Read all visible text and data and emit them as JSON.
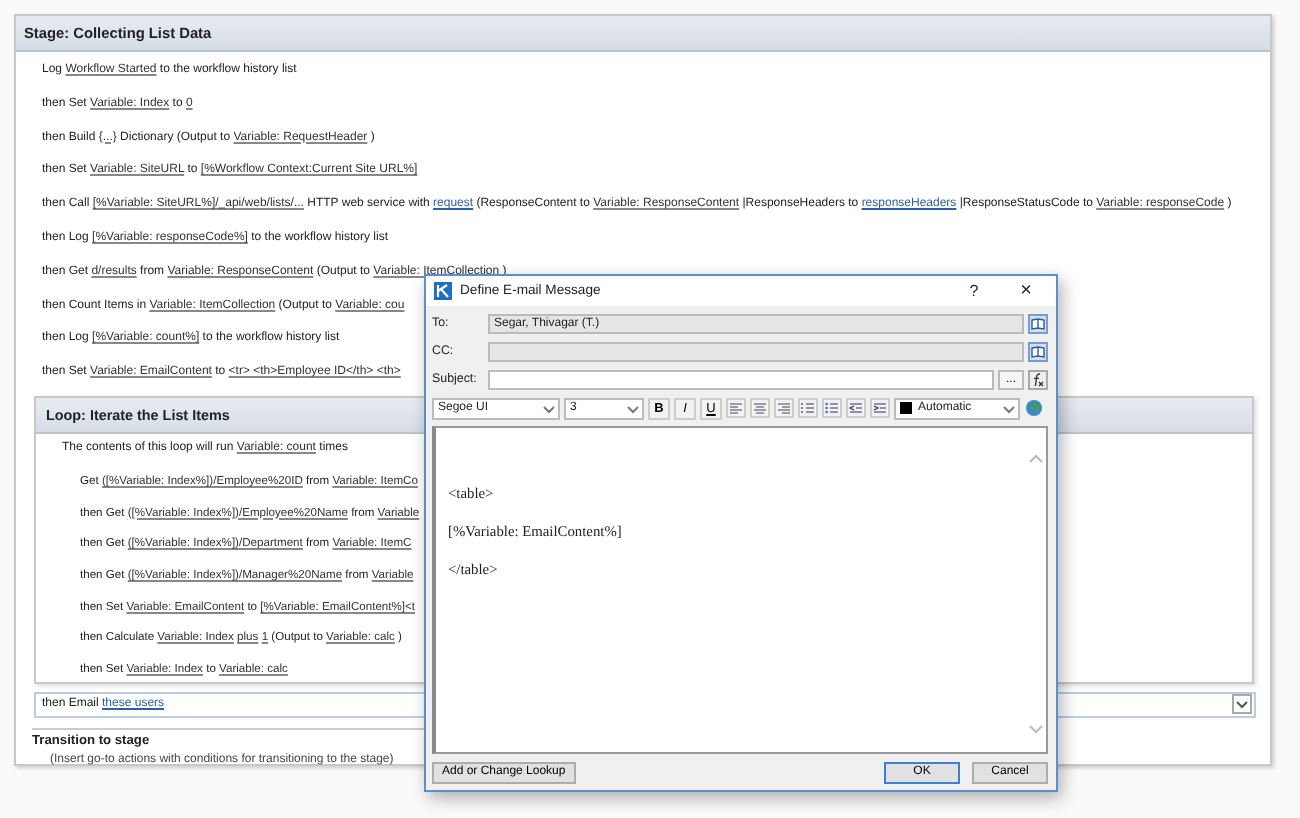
{
  "stage": {
    "title": "Stage: Collecting List Data",
    "actions": [
      {
        "segments": [
          {
            "kind": "text",
            "text": "Log "
          },
          {
            "kind": "var",
            "text": "Workflow Started"
          },
          {
            "kind": "text",
            "text": " to the workflow history list"
          }
        ]
      },
      {
        "segments": [
          {
            "kind": "text",
            "text": "then Set "
          },
          {
            "kind": "var",
            "text": "Variable: Index"
          },
          {
            "kind": "text",
            "text": " to "
          },
          {
            "kind": "var",
            "text": "0"
          }
        ]
      },
      {
        "segments": [
          {
            "kind": "text",
            "text": "then Build "
          },
          {
            "kind": "var",
            "text": "{...}"
          },
          {
            "kind": "text",
            "text": " Dictionary (Output to "
          },
          {
            "kind": "var",
            "text": "Variable: RequestHeader"
          },
          {
            "kind": "text",
            "text": " )"
          }
        ]
      },
      {
        "segments": [
          {
            "kind": "text",
            "text": "then Set "
          },
          {
            "kind": "var",
            "text": "Variable: SiteURL"
          },
          {
            "kind": "text",
            "text": " to "
          },
          {
            "kind": "var",
            "text": "[%Workflow Context:Current Site URL%]"
          }
        ]
      },
      {
        "segments": [
          {
            "kind": "text",
            "text": "then Call "
          },
          {
            "kind": "var",
            "text": "[%Variable: SiteURL%]/_api/web/lists/..."
          },
          {
            "kind": "text",
            "text": " HTTP web service with "
          },
          {
            "kind": "param",
            "text": "request"
          },
          {
            "kind": "text",
            "text": " (ResponseContent to "
          },
          {
            "kind": "var",
            "text": "Variable: ResponseContent"
          },
          {
            "kind": "text",
            "text": " |ResponseHeaders to "
          },
          {
            "kind": "param",
            "text": "responseHeaders"
          },
          {
            "kind": "text",
            "text": " |ResponseStatusCode to "
          },
          {
            "kind": "var",
            "text": "Variable: responseCode"
          },
          {
            "kind": "text",
            "text": " )"
          }
        ]
      },
      {
        "segments": [
          {
            "kind": "text",
            "text": "then Log "
          },
          {
            "kind": "var",
            "text": "[%Variable: responseCode%]"
          },
          {
            "kind": "text",
            "text": " to the workflow history list"
          }
        ]
      },
      {
        "segments": [
          {
            "kind": "text",
            "text": "then Get "
          },
          {
            "kind": "var",
            "text": "d/results"
          },
          {
            "kind": "text",
            "text": " from "
          },
          {
            "kind": "var",
            "text": "Variable: ResponseContent"
          },
          {
            "kind": "text",
            "text": " (Output to "
          },
          {
            "kind": "var",
            "text": "Variable: ItemCollection"
          },
          {
            "kind": "text",
            "text": " )"
          }
        ]
      },
      {
        "segments": [
          {
            "kind": "text",
            "text": "then Count Items in "
          },
          {
            "kind": "var",
            "text": "Variable: ItemCollection"
          },
          {
            "kind": "text",
            "text": " (Output to "
          },
          {
            "kind": "var",
            "text": "Variable: cou"
          }
        ]
      },
      {
        "segments": [
          {
            "kind": "text",
            "text": "then Log "
          },
          {
            "kind": "var",
            "text": "[%Variable: count%]"
          },
          {
            "kind": "text",
            "text": " to the workflow history list"
          }
        ]
      },
      {
        "segments": [
          {
            "kind": "text",
            "text": "then Set "
          },
          {
            "kind": "var",
            "text": "Variable: EmailContent"
          },
          {
            "kind": "text",
            "text": " to "
          },
          {
            "kind": "var",
            "text": "<tr> <th>Employee ID</th> <th>"
          }
        ]
      }
    ]
  },
  "loop": {
    "title": "Loop: Iterate the List Items",
    "description": [
      {
        "kind": "text",
        "text": "The contents of this loop will run "
      },
      {
        "kind": "var",
        "text": "Variable: count"
      },
      {
        "kind": "text",
        "text": " times"
      }
    ],
    "actions": [
      {
        "segments": [
          {
            "kind": "text",
            "text": "Get "
          },
          {
            "kind": "var",
            "text": "([%Variable: Index%])/Employee%20ID"
          },
          {
            "kind": "text",
            "text": " from "
          },
          {
            "kind": "var",
            "text": "Variable: ItemCo"
          }
        ]
      },
      {
        "segments": [
          {
            "kind": "text",
            "text": "then Get "
          },
          {
            "kind": "var",
            "text": "([%Variable: Index%])/Employee%20Name"
          },
          {
            "kind": "text",
            "text": " from "
          },
          {
            "kind": "var",
            "text": "Variable"
          }
        ]
      },
      {
        "segments": [
          {
            "kind": "text",
            "text": "then Get "
          },
          {
            "kind": "var",
            "text": "([%Variable: Index%])/Department"
          },
          {
            "kind": "text",
            "text": " from "
          },
          {
            "kind": "var",
            "text": "Variable: ItemC"
          }
        ]
      },
      {
        "segments": [
          {
            "kind": "text",
            "text": "then Get "
          },
          {
            "kind": "var",
            "text": "([%Variable: Index%])/Manager%20Name"
          },
          {
            "kind": "text",
            "text": " from "
          },
          {
            "kind": "var",
            "text": "Variable"
          }
        ]
      },
      {
        "segments": [
          {
            "kind": "text",
            "text": "then Set "
          },
          {
            "kind": "var",
            "text": "Variable: EmailContent"
          },
          {
            "kind": "text",
            "text": " to "
          },
          {
            "kind": "var",
            "text": "[%Variable: EmailContent%]<t"
          }
        ]
      },
      {
        "segments": [
          {
            "kind": "text",
            "text": "then Calculate "
          },
          {
            "kind": "var",
            "text": "Variable: Index"
          },
          {
            "kind": "var",
            "text": "plus",
            "space_before": true
          },
          {
            "kind": "var",
            "text": "1",
            "space_before": true
          },
          {
            "kind": "text",
            "text": " (Output to "
          },
          {
            "kind": "var",
            "text": "Variable: calc"
          },
          {
            "kind": "text",
            "text": " )"
          }
        ]
      },
      {
        "segments": [
          {
            "kind": "text",
            "text": "then Set "
          },
          {
            "kind": "var",
            "text": "Variable: Index"
          },
          {
            "kind": "text",
            "text": " to "
          },
          {
            "kind": "var",
            "text": "Variable: calc"
          }
        ]
      }
    ]
  },
  "email_action": {
    "segments": [
      {
        "kind": "text",
        "text": "then Email "
      },
      {
        "kind": "param",
        "text": "these users"
      }
    ],
    "selected": true
  },
  "transition": {
    "title": "Transition to stage",
    "hint": "(Insert go-to actions with conditions for transitioning to the stage)"
  },
  "dialog": {
    "title": "Define E-mail Message",
    "help": "?",
    "close": "×",
    "fields": [
      {
        "label": "To:",
        "value": "Segar, Thivagar (T.)",
        "kind": "address"
      },
      {
        "label": "CC:",
        "kind": "address"
      },
      {
        "label": "Subject:",
        "kind": "subject",
        "button": "..."
      }
    ],
    "toolbar": {
      "font": "Segoe UI",
      "size": "3",
      "color_label": "Automatic",
      "bold": "B",
      "italic": "I",
      "underline": "U"
    },
    "body": [
      "<table>",
      "[%Variable: EmailContent%]",
      "</table>"
    ],
    "lookup_button": "Add or Change Lookup",
    "buttons": [
      {
        "label": "OK",
        "default": true
      },
      {
        "label": "Cancel",
        "default": false
      }
    ]
  }
}
